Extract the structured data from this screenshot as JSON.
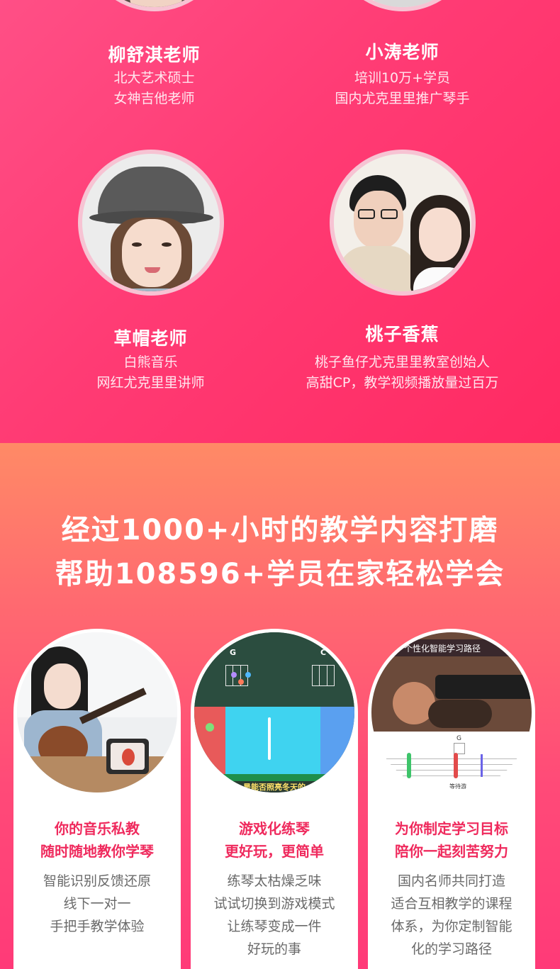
{
  "teachers": [
    {
      "name": "柳舒淇老师",
      "lines": [
        "北大艺术硕士",
        "女神吉他老师"
      ]
    },
    {
      "name": "小涛老师",
      "lines": [
        "培训10万+学员",
        "国内尤克里里推广琴手"
      ]
    },
    {
      "name": "草帽老师",
      "lines": [
        "白熊音乐",
        "网红尤克里里讲师"
      ]
    },
    {
      "name": "桃子香蕉",
      "lines": [
        "桃子鱼仔尤克里里教室创始人",
        "高甜CP，教学视频播放量过百万"
      ]
    }
  ],
  "headline": {
    "line1": "经过1000+小时的教学内容打磨",
    "line2": "帮助108596+学员在家轻松学会"
  },
  "cards": [
    {
      "title1": "你的音乐私教",
      "title2": "随时随地教你学琴",
      "body": [
        "智能识别反馈还原",
        "线下一对一",
        "手把手教学体验"
      ]
    },
    {
      "title1": "游戏化练琴",
      "title2": "更好玩，更简单",
      "body": [
        "练琴太枯燥乏味",
        "试试切换到游戏模式",
        "让练琴变成一件",
        "好玩的事"
      ],
      "screen": {
        "chord_left": "G",
        "chord_right": "C",
        "lyric": "是能否照亮冬天的"
      }
    },
    {
      "title1": "为你制定学习目标",
      "title2": "陪你一起刻苦努力",
      "body": [
        "国内名师共同打造",
        "适合互相教学的课程",
        "体系，为你定制智能",
        "化的学习路径"
      ],
      "screen": {
        "banner": "个性化智能学习路径",
        "chord": "G",
        "caption": "等待游"
      }
    }
  ],
  "colors": {
    "accent": "#ef2a5d",
    "pink_top": "#ff4f86",
    "orange": "#ff8a66"
  }
}
